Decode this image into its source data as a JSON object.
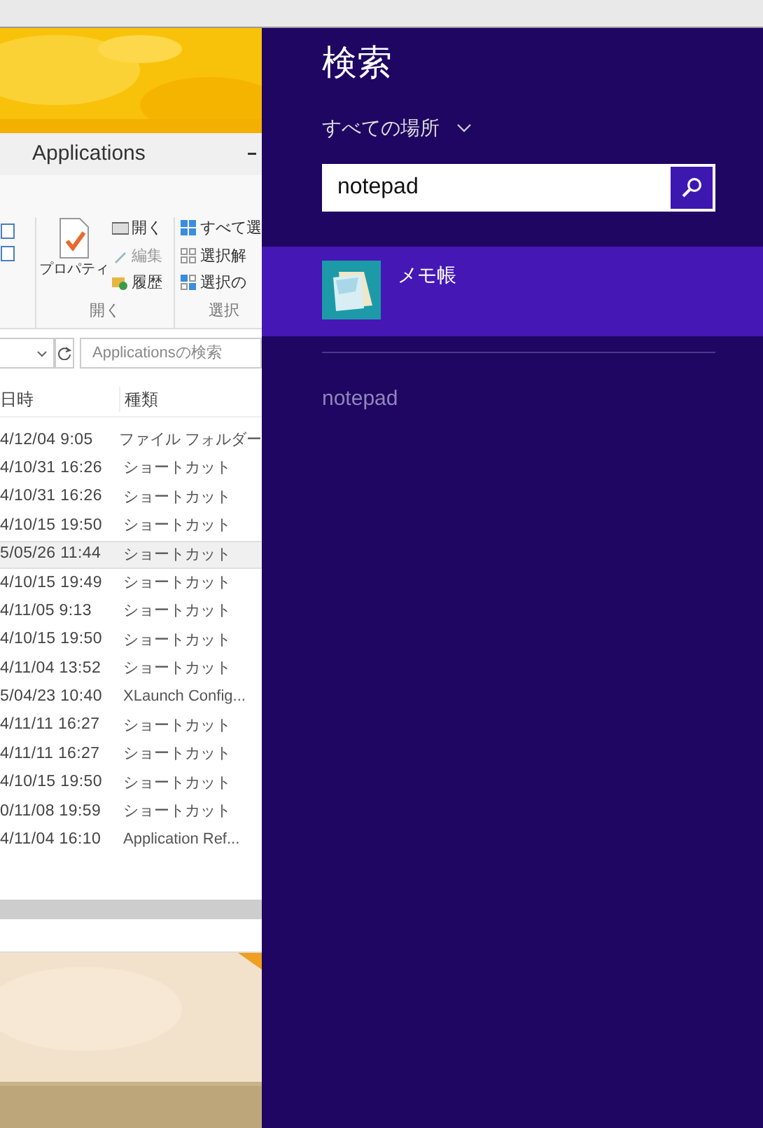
{
  "explorer": {
    "title": "Applications",
    "ribbon": {
      "open_group": {
        "properties": "プロパティ",
        "open": "開く",
        "edit": {
          "label": "編集",
          "disabled": true
        },
        "history": "履歴",
        "label": "開く"
      },
      "select_group": {
        "select_all": "すべて選",
        "select_none": "選択解",
        "invert": "選択の",
        "label": "選択"
      }
    },
    "search": {
      "placeholder": "Applicationsの検索"
    },
    "columns": [
      "日時",
      "種類"
    ],
    "rows": [
      {
        "date": "4/12/04 9:05",
        "type": "ファイル フォルダー",
        "selected": false
      },
      {
        "date": "4/10/31 16:26",
        "type": "ショートカット",
        "selected": false
      },
      {
        "date": "4/10/31 16:26",
        "type": "ショートカット",
        "selected": false
      },
      {
        "date": "4/10/15 19:50",
        "type": "ショートカット",
        "selected": false
      },
      {
        "date": "5/05/26 11:44",
        "type": "ショートカット",
        "selected": true
      },
      {
        "date": "4/10/15 19:49",
        "type": "ショートカット",
        "selected": false
      },
      {
        "date": "4/11/05 9:13",
        "type": "ショートカット",
        "selected": false
      },
      {
        "date": "4/10/15 19:50",
        "type": "ショートカット",
        "selected": false
      },
      {
        "date": "4/11/04 13:52",
        "type": "ショートカット",
        "selected": false
      },
      {
        "date": "5/04/23 10:40",
        "type": "XLaunch Config...",
        "selected": false
      },
      {
        "date": "4/11/11 16:27",
        "type": "ショートカット",
        "selected": false
      },
      {
        "date": "4/11/11 16:27",
        "type": "ショートカット",
        "selected": false
      },
      {
        "date": "4/10/15 19:50",
        "type": "ショートカット",
        "selected": false
      },
      {
        "date": "0/11/08 19:59",
        "type": "ショートカット",
        "selected": false
      },
      {
        "date": "4/11/04 16:10",
        "type": "Application Ref...",
        "selected": false
      }
    ]
  },
  "search_pane": {
    "title": "検索",
    "scope": "すべての場所",
    "query": "notepad",
    "results": [
      {
        "label": "メモ帳",
        "selected": true
      }
    ],
    "suggestions": [
      "notepad"
    ]
  }
}
